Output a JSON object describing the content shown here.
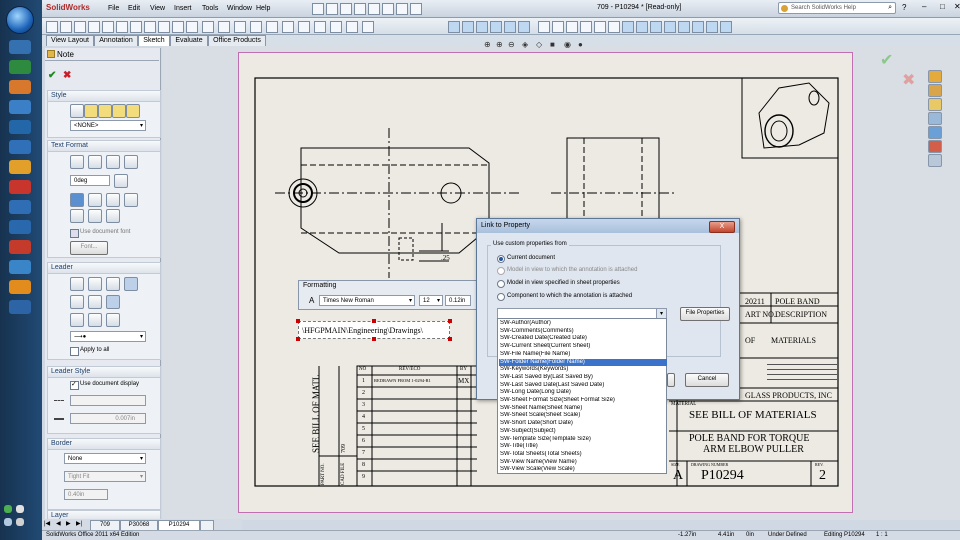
{
  "app": {
    "logo": "SolidWorks",
    "window_title": "709 - P10294 * [Read-only]",
    "search_placeholder": "Search SolidWorks Help",
    "menu": [
      "File",
      "Edit",
      "View",
      "Insert",
      "Tools",
      "Window",
      "Help"
    ]
  },
  "tabs": [
    {
      "label": "View Layout"
    },
    {
      "label": "Annotation"
    },
    {
      "label": "Sketch",
      "active": true
    },
    {
      "label": "Evaluate"
    },
    {
      "label": "Office Products"
    }
  ],
  "property_manager": {
    "title": "Note",
    "sections": {
      "style": {
        "title": "Style",
        "dropdown": "<NONE>"
      },
      "text_format": {
        "title": "Text Format",
        "angle": "0deg",
        "use_doc_font": "Use document font",
        "font_button": "Font..."
      },
      "leader": {
        "title": "Leader",
        "apply_to_all": "Apply to all"
      },
      "leader_style": {
        "title": "Leader Style",
        "use_doc_display": "Use document display",
        "thickness": "0.007in"
      },
      "border": {
        "title": "Border",
        "style": "None",
        "size": "Tight Fit",
        "padding": "0.40in"
      },
      "layer": {
        "title": "Layer"
      }
    }
  },
  "formatting": {
    "title": "Formatting",
    "font": "Times New Roman",
    "size": "12",
    "height": "0.12in",
    "note_text": "\\HFGPMAIN\\Engineering\\Drawings\\"
  },
  "dialog": {
    "title": "Link to Property",
    "close": "X",
    "group_label": "Use custom properties from",
    "options": [
      {
        "label": "Current document",
        "selected": true,
        "enabled": true
      },
      {
        "label": "Model in view to which the annotation is attached",
        "selected": false,
        "enabled": false
      },
      {
        "label": "Model in view specified in sheet properties",
        "selected": false,
        "enabled": true
      },
      {
        "label": "Component to which the annotation is attached",
        "selected": false,
        "enabled": true
      }
    ],
    "file_properties": "File Properties",
    "ok": "OK",
    "cancel": "Cancel"
  },
  "property_list": [
    "SW-Author(Author)",
    "SW-Comments(Comments)",
    "SW-Created Date(Created Date)",
    "SW-Current Sheet(Current Sheet)",
    "SW-File Name(File Name)",
    "SW-Folder Name(Folder Name)",
    "SW-Keywords(Keywords)",
    "SW-Last Saved By(Last Saved By)",
    "SW-Last Saved Date(Last Saved Date)",
    "SW-Long Date(Long Date)",
    "SW-Sheet Format Size(Sheet Format Size)",
    "SW-Sheet Name(Sheet Name)",
    "SW-Sheet Scale(Sheet Scale)",
    "SW-Short Date(Short Date)",
    "SW-Subject(Subject)",
    "SW-Template Size(Template Size)",
    "SW-Title(Title)",
    "SW-Total Sheets(Total Sheets)",
    "SW-View Name(View Name)",
    "SW-View Scale(View Scale)"
  ],
  "selected_property_index": 5,
  "drawing": {
    "dimension": ".25",
    "bom_header": [
      "NO",
      "REV/ECO",
      "BY"
    ],
    "bom_rows": [
      "1",
      "2",
      "3",
      "4",
      "5",
      "6",
      "7",
      "8",
      "9",
      "10"
    ],
    "row1_text": "REDRAWN FROM 1-0294-R1",
    "row1_by": "MX",
    "side_label": "SEE BILL OF MATL",
    "side_num": "709",
    "side_part": "PART NO.",
    "side_cad": "CAD FILE",
    "tb_year": "20211",
    "tb_pole_band": "POLE BAND",
    "tb_part_no": "ART NO.",
    "tb_description": "DESCRIPTION",
    "tb_of": "OF",
    "tb_materials": "MATERIALS",
    "tb_company": "GLASS PRODUCTS, INC",
    "tb_material_lbl": "MATERIAL",
    "tb_material": "SEE BILL OF MATERIALS",
    "tb_title1": "POLE BAND FOR TORQUE",
    "tb_title2": "ARM ELBOW PULLER",
    "tb_size_lbl": "SIZE",
    "tb_size": "A",
    "tb_dwg_lbl": "DRAWING NUMBER",
    "tb_dwg": "P10294",
    "tb_rev_lbl": "REV.",
    "tb_rev": "2"
  },
  "sheet_tabs": [
    "709",
    "P30068",
    "P10294"
  ],
  "status": {
    "edition": "SolidWorks Office 2011 x64 Edition",
    "x": "-1.27in",
    "y": "4.41in",
    "z": "0in",
    "state": "Under Defined",
    "editing": "Editing P10294",
    "scale": "1 : 1"
  }
}
